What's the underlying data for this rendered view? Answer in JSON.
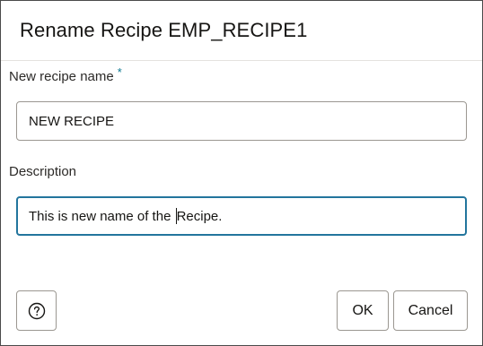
{
  "dialog": {
    "title": "Rename Recipe EMP_RECIPE1"
  },
  "name_field": {
    "label": "New recipe name",
    "required_marker": "*",
    "value": "NEW RECIPE"
  },
  "description_field": {
    "label": "Description",
    "value_before_caret": "This is new name of the ",
    "value_after_caret": "Recipe."
  },
  "buttons": {
    "help_icon": "question-circle-icon",
    "ok_label": "OK",
    "cancel_label": "Cancel"
  },
  "colors": {
    "focus_border": "#23759d",
    "required_marker": "#0c7891"
  }
}
